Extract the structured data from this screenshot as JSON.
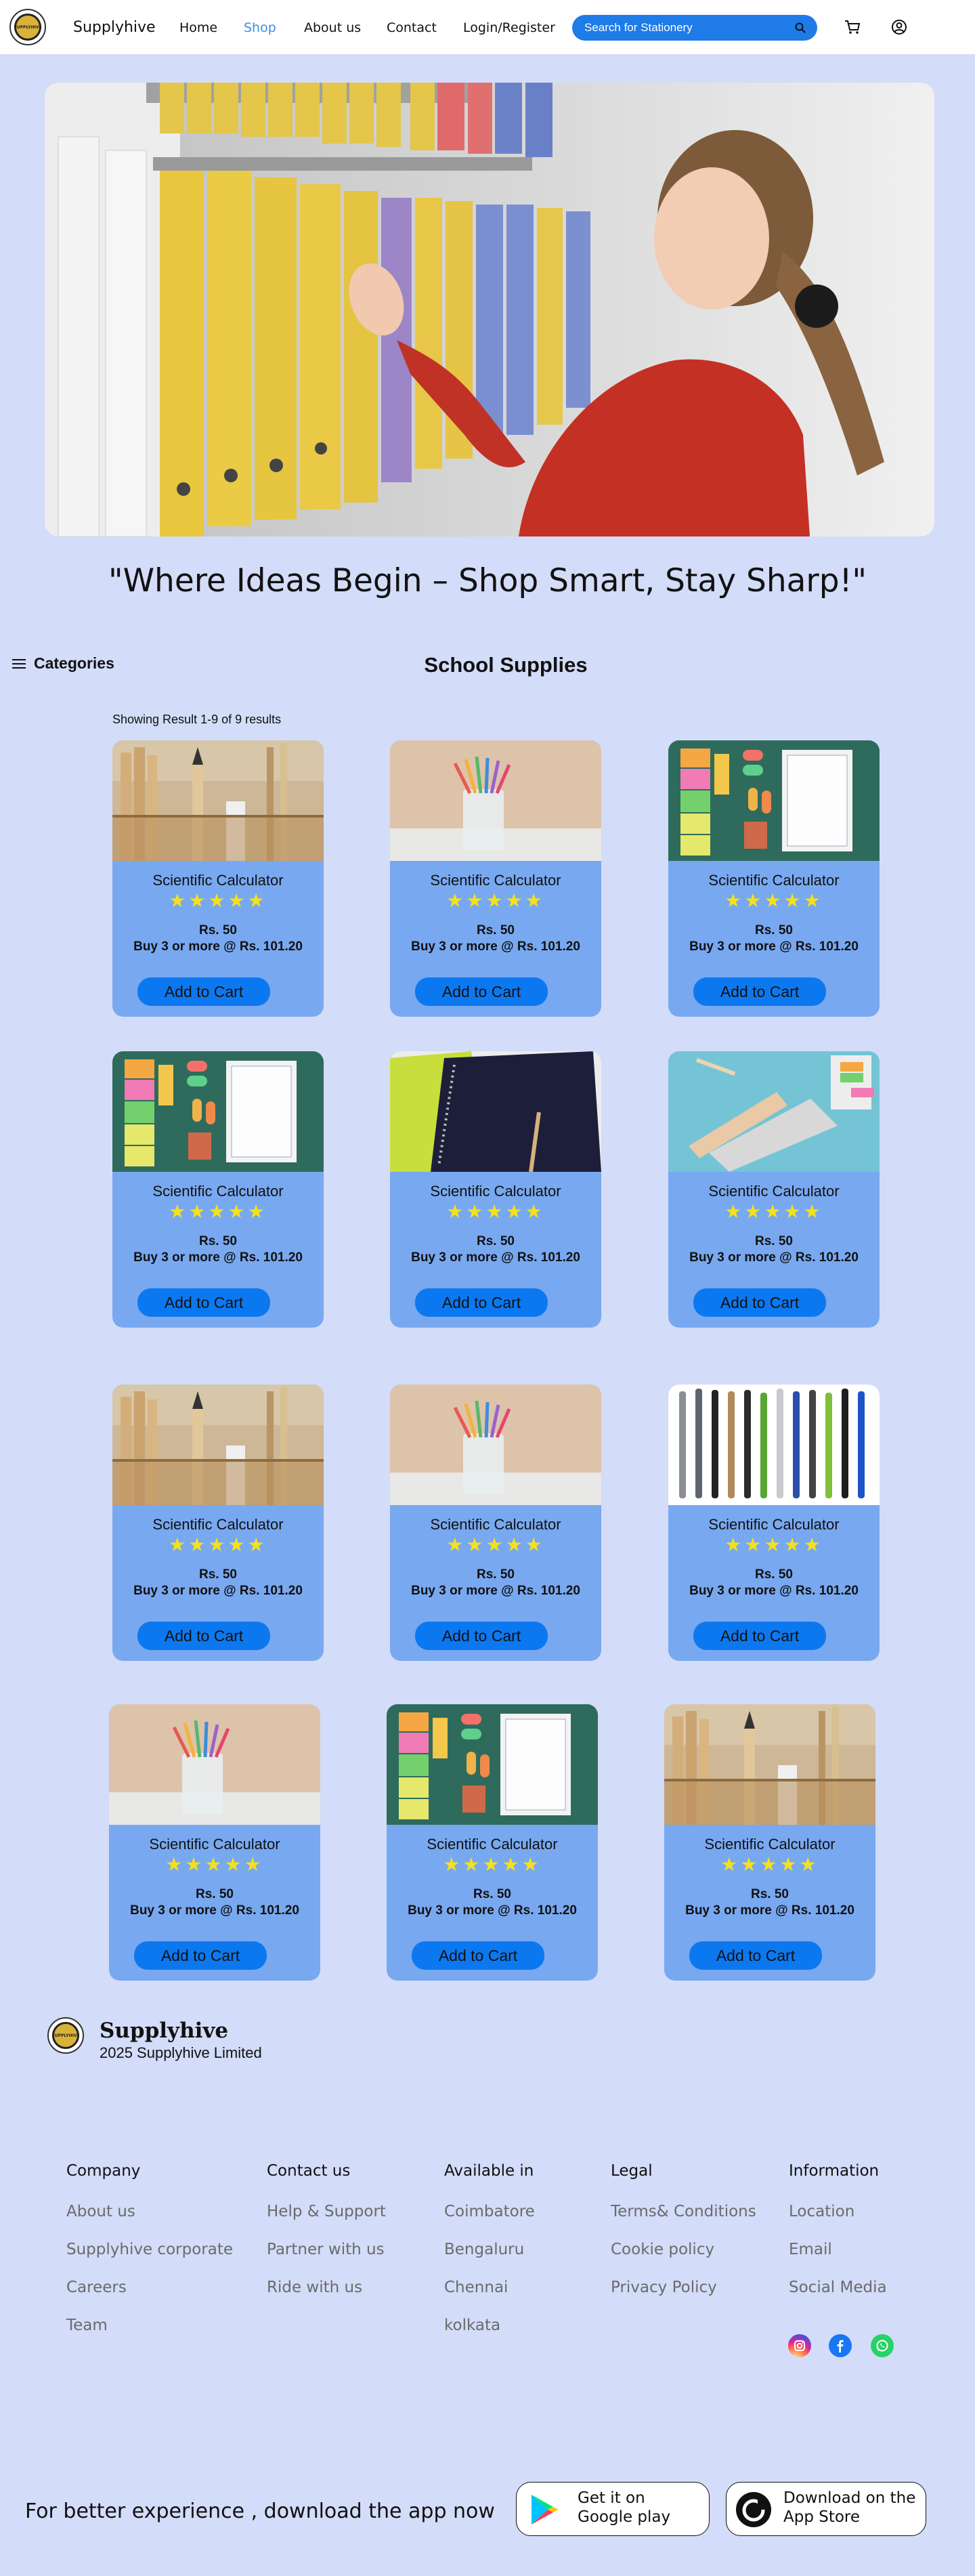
{
  "nav": {
    "brand": "Supplyhive",
    "logo_text": "SUPPLYHIVE",
    "links": [
      "Home",
      "Shop",
      "About us",
      "Contact",
      "Login/Register"
    ],
    "active_link": "Shop",
    "search_placeholder": "Search for Stationery",
    "icons": [
      "search-icon",
      "cart-icon",
      "user-icon"
    ],
    "accent_color": "#1e7be8"
  },
  "hero": {
    "tagline": "\"Where Ideas Begin – Shop Smart, Stay Sharp!\""
  },
  "categories_label": "Categories",
  "section_title": "School Supplies",
  "results_text": "Showing Result 1-9 of 9 results",
  "products": [
    {
      "name": "Scientific Calculator",
      "stars": "★★★★★",
      "price": "Rs. 50",
      "bulk": "Buy 3 or more @ Rs. 101.20",
      "button": "Add to Cart",
      "image": "ruler-pencil-holder"
    },
    {
      "name": "Scientific Calculator",
      "stars": "★★★★★",
      "price": "Rs. 50",
      "bulk": "Buy 3 or more @ Rs. 101.20",
      "button": "Add to Cart",
      "image": "colored-pencils-cup"
    },
    {
      "name": "Scientific Calculator",
      "stars": "★★★★★",
      "price": "Rs. 50",
      "bulk": "Buy 3 or more @ Rs. 101.20",
      "button": "Add to Cart",
      "image": "sticky-notes-notepad"
    },
    {
      "name": "Scientific Calculator",
      "stars": "★★★★★",
      "price": "Rs. 50",
      "bulk": "Buy 3 or more @ Rs. 101.20",
      "button": "Add to Cart",
      "image": "sticky-notes-notepad"
    },
    {
      "name": "Scientific Calculator",
      "stars": "★★★★★",
      "price": "Rs. 50",
      "bulk": "Buy 3 or more @ Rs. 101.20",
      "button": "Add to Cart",
      "image": "spiral-notebooks"
    },
    {
      "name": "Scientific Calculator",
      "stars": "★★★★★",
      "price": "Rs. 50",
      "bulk": "Buy 3 or more @ Rs. 101.20",
      "button": "Add to Cart",
      "image": "pencil-case-desk"
    },
    {
      "name": "Scientific Calculator",
      "stars": "★★★★★",
      "price": "Rs. 50",
      "bulk": "Buy 3 or more @ Rs. 101.20",
      "button": "Add to Cart",
      "image": "ruler-pencil-holder"
    },
    {
      "name": "Scientific Calculator",
      "stars": "★★★★★",
      "price": "Rs. 50",
      "bulk": "Buy 3 or more @ Rs. 101.20",
      "button": "Add to Cart",
      "image": "colored-pencils-cup"
    },
    {
      "name": "Scientific Calculator",
      "stars": "★★★★★",
      "price": "Rs. 50",
      "bulk": "Buy 3 or more @ Rs. 101.20",
      "button": "Add to Cart",
      "image": "pens-row"
    },
    {
      "name": "Scientific Calculator",
      "stars": "★★★★★",
      "price": "Rs. 50",
      "bulk": "Buy 3 or more @ Rs. 101.20",
      "button": "Add to Cart",
      "image": "colored-pencils-cup"
    },
    {
      "name": "Scientific Calculator",
      "stars": "★★★★★",
      "price": "Rs. 50",
      "bulk": "Buy 3 or more @ Rs. 101.20",
      "button": "Add to Cart",
      "image": "sticky-notes-notepad"
    },
    {
      "name": "Scientific Calculator",
      "stars": "★★★★★",
      "price": "Rs. 50",
      "bulk": "Buy 3 or more @ Rs. 101.20",
      "button": "Add to Cart",
      "image": "ruler-pencil-holder"
    }
  ],
  "footer": {
    "brand": "Supplyhive",
    "copyright": "2025 Supplyhive Limited",
    "columns": [
      {
        "title": "Company",
        "items": [
          "About us",
          "Supplyhive corporate",
          "Careers",
          "Team"
        ]
      },
      {
        "title": "Contact us",
        "items": [
          "Help & Support",
          "Partner with us",
          "Ride with us"
        ]
      },
      {
        "title": "Available in",
        "items": [
          "Coimbatore",
          "Bengaluru",
          "Chennai",
          "kolkata"
        ]
      },
      {
        "title": "Legal",
        "items": [
          "Terms& Conditions",
          "Cookie policy",
          "Privacy Policy"
        ]
      },
      {
        "title": "Information",
        "items": [
          "Location",
          "Email",
          "Social Media"
        ]
      }
    ],
    "social_icons": [
      "instagram-icon",
      "facebook-icon",
      "whatsapp-icon"
    ],
    "download_text": "For better experience , download the app now",
    "google_play": {
      "line1": "Get it on",
      "line2": "Google play"
    },
    "app_store": {
      "line1": "Download on the",
      "line2": "App Store"
    }
  }
}
